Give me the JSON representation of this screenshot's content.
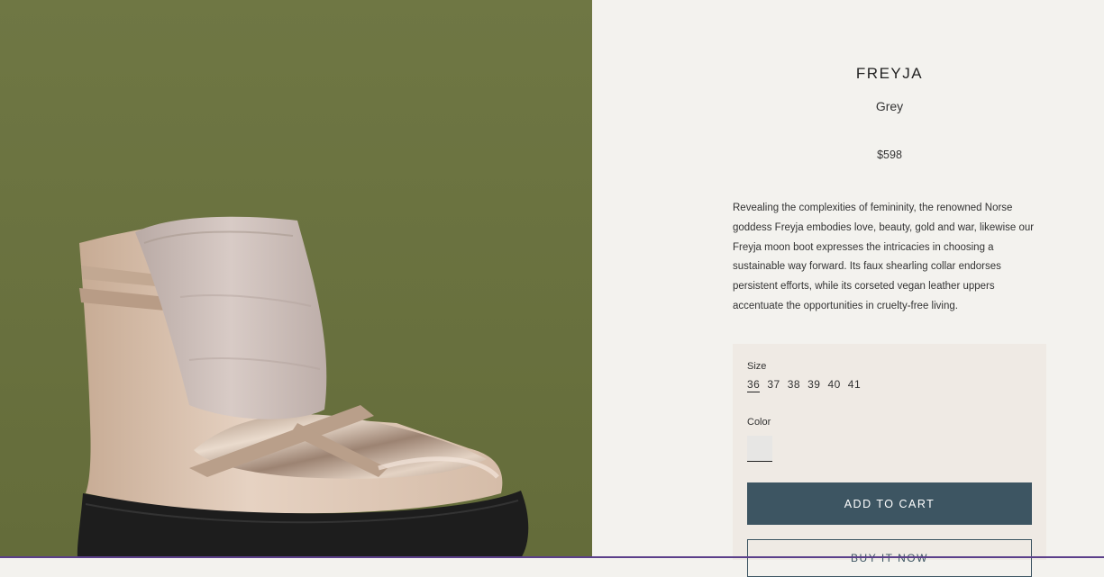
{
  "product": {
    "image_alt": "Freyja grey faux shearling moon boot",
    "name": "FREYJA",
    "color_name": "Grey",
    "price": "$598",
    "description": "Revealing the complexities of femininity, the renowned Norse goddess Freyja embodies love, beauty, gold and war, likewise our Freyja moon boot expresses the intricacies in choosing a sustainable way forward. Its faux shearling collar endorses persistent efforts, while its corseted vegan leather uppers accentuate the opportunities in cruelty-free living."
  },
  "form": {
    "size_label": "Size",
    "sizes": [
      "36",
      "37",
      "38",
      "39",
      "40",
      "41"
    ],
    "selected_size": "36",
    "color_label": "Color",
    "swatch_color": "#e7e6e4",
    "add_to_cart_label": "ADD TO CART",
    "buy_now_label": "BUY IT NOW"
  },
  "colors": {
    "image_background": "#6b7441",
    "page_background": "#f3f2ee",
    "form_background": "#efeae4",
    "button_primary": "#3d5562"
  }
}
